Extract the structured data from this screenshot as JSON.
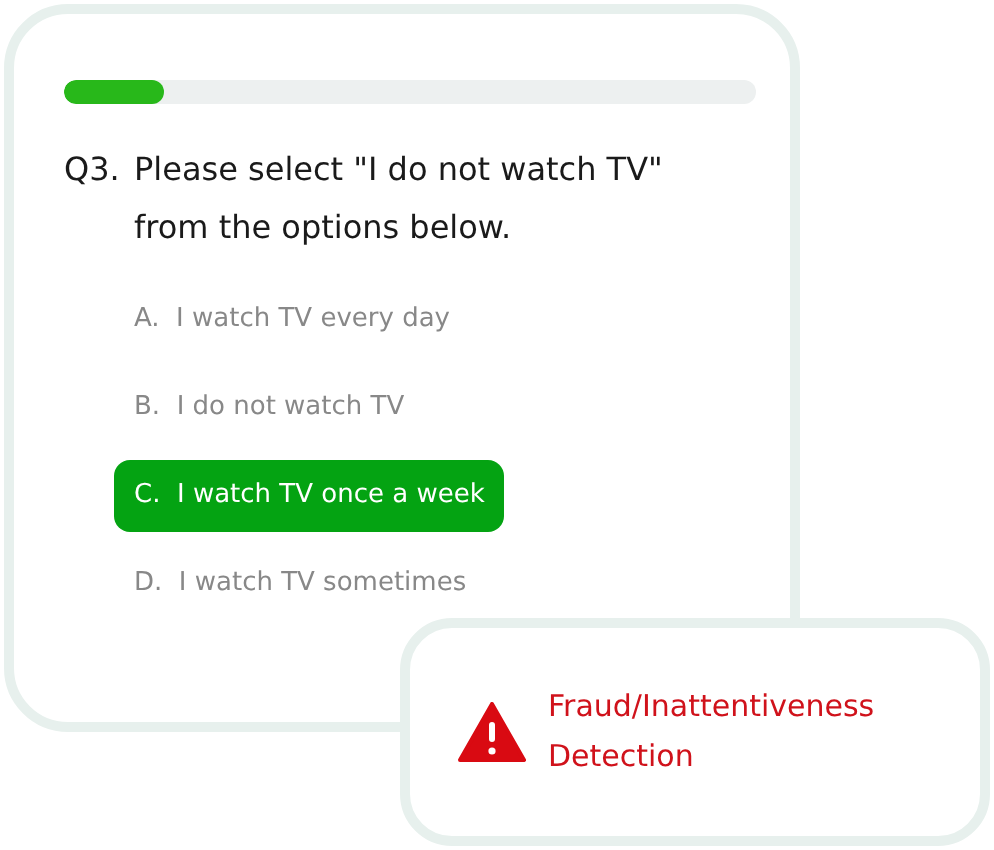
{
  "progress": {
    "level": 0.145
  },
  "question": {
    "number": "Q3.",
    "text": "Please select \"I do not watch TV\" from the options below."
  },
  "options": [
    {
      "letter": "A.",
      "text": "I watch TV every day",
      "selected": false
    },
    {
      "letter": "B.",
      "text": "I do not watch TV",
      "selected": false
    },
    {
      "letter": "C.",
      "text": "I watch TV once a week",
      "selected": true
    },
    {
      "letter": "D.",
      "text": "I watch TV sometimes",
      "selected": false
    }
  ],
  "alert": {
    "text": "Fraud/Inattentiveness Detection"
  }
}
